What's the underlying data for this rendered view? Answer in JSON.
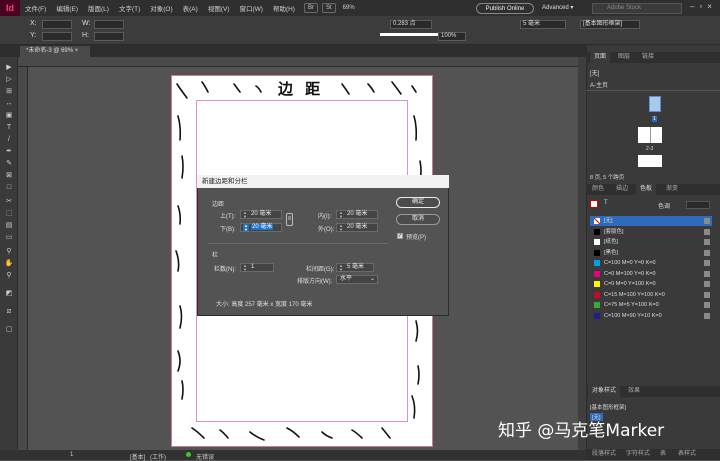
{
  "app": {
    "logo": "Id"
  },
  "menu": [
    "文件(F)",
    "编辑(E)",
    "版面(L)",
    "文字(T)",
    "对象(O)",
    "表(A)",
    "视图(V)",
    "窗口(W)",
    "帮助(H)"
  ],
  "topbar": {
    "br": "Br",
    "st": "St",
    "zoom": "69%",
    "publish": "Publish Online",
    "workspace": "Advanced ▾",
    "stock_placeholder": "Adobe Stock"
  },
  "control": {
    "x_label": "X:",
    "y_label": "Y:",
    "w_label": "W:",
    "h_label": "H:",
    "stroke": "0.283 点",
    "pct": "100%",
    "gutter": "5 毫米",
    "style": "[基本图形框架]"
  },
  "doc_tab": "*未命名-3 @ 69% ×",
  "page": {
    "title": "边 距"
  },
  "dialog": {
    "title": "新建边距和分栏",
    "section_margin": "边距",
    "top_label": "上(T):",
    "top_value": "20 毫米",
    "bottom_label": "下(B):",
    "bottom_value": "20 毫米",
    "inside_label": "内(I):",
    "inside_value": "20 毫米",
    "outside_label": "外(O):",
    "outside_value": "20 毫米",
    "section_columns": "栏",
    "count_label": "栏数(N):",
    "count_value": "1",
    "gutter_label": "栏间距(G):",
    "gutter_value": "5 毫米",
    "direction_label": "排版方向(W):",
    "direction_value": "水平",
    "size_text": "大小: 高度 257 毫米 x 宽度 170 毫米",
    "ok": "确定",
    "cancel": "取消",
    "preview": "预览(P)"
  },
  "panels": {
    "pages_tabs": [
      "页面",
      "图层",
      "链接"
    ],
    "none_master": "[无]",
    "a_master": "A-主页",
    "spread_label": "2-3",
    "page_num": "1",
    "pages_status": "8 页, 5 个跨页",
    "swatch_tabs": [
      "颜色",
      "描边",
      "色板",
      "渐变"
    ],
    "tint_label": "色调",
    "swatches": [
      {
        "name": "[无]",
        "color": "#ffffff"
      },
      {
        "name": "[套版色]",
        "color": "#000000"
      },
      {
        "name": "[纸色]",
        "color": "#ffffff"
      },
      {
        "name": "[黑色]",
        "color": "#000000"
      },
      {
        "name": "C=100 M=0 Y=0 K=0",
        "color": "#00a0e9"
      },
      {
        "name": "C=0 M=100 Y=0 K=0",
        "color": "#e4007f"
      },
      {
        "name": "C=0 M=0 Y=100 K=0",
        "color": "#fff100"
      },
      {
        "name": "C=15 M=100 Y=100 K=0",
        "color": "#c30d23"
      },
      {
        "name": "C=75 M=5 Y=100 K=0",
        "color": "#3aa935"
      },
      {
        "name": "C=100 M=90 Y=10 K=0",
        "color": "#1d2088"
      }
    ],
    "obj_tabs": [
      "对象样式",
      "效果"
    ],
    "obj_items": [
      "[基本图形框架]",
      "[无]"
    ],
    "bottom_tabs": [
      "段落样式",
      "字符样式",
      "表",
      "表样式"
    ]
  },
  "status": {
    "page": "1",
    "master": "[基本]",
    "mode": "(工作)",
    "errors": "无错误"
  },
  "watermark": "知乎 @马克笔Marker"
}
